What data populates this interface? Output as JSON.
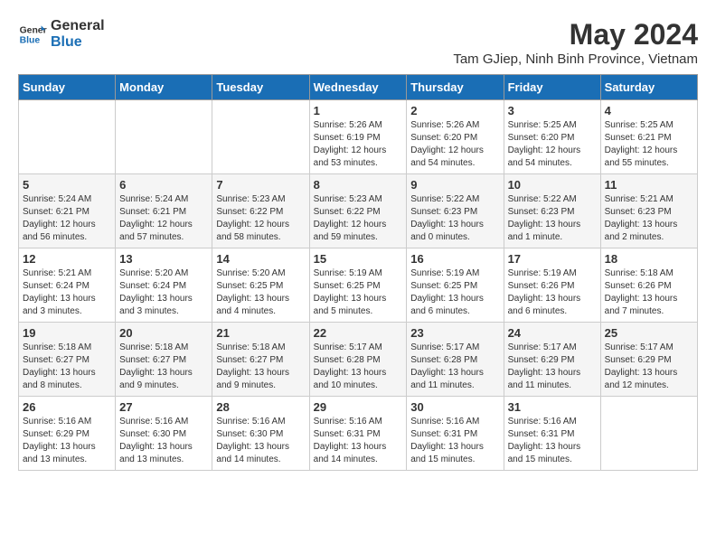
{
  "logo": {
    "line1": "General",
    "line2": "Blue"
  },
  "title": "May 2024",
  "location": "Tam GJiep, Ninh Binh Province, Vietnam",
  "days_of_week": [
    "Sunday",
    "Monday",
    "Tuesday",
    "Wednesday",
    "Thursday",
    "Friday",
    "Saturday"
  ],
  "weeks": [
    [
      {
        "day": "",
        "info": ""
      },
      {
        "day": "",
        "info": ""
      },
      {
        "day": "",
        "info": ""
      },
      {
        "day": "1",
        "info": "Sunrise: 5:26 AM\nSunset: 6:19 PM\nDaylight: 12 hours\nand 53 minutes."
      },
      {
        "day": "2",
        "info": "Sunrise: 5:26 AM\nSunset: 6:20 PM\nDaylight: 12 hours\nand 54 minutes."
      },
      {
        "day": "3",
        "info": "Sunrise: 5:25 AM\nSunset: 6:20 PM\nDaylight: 12 hours\nand 54 minutes."
      },
      {
        "day": "4",
        "info": "Sunrise: 5:25 AM\nSunset: 6:21 PM\nDaylight: 12 hours\nand 55 minutes."
      }
    ],
    [
      {
        "day": "5",
        "info": "Sunrise: 5:24 AM\nSunset: 6:21 PM\nDaylight: 12 hours\nand 56 minutes."
      },
      {
        "day": "6",
        "info": "Sunrise: 5:24 AM\nSunset: 6:21 PM\nDaylight: 12 hours\nand 57 minutes."
      },
      {
        "day": "7",
        "info": "Sunrise: 5:23 AM\nSunset: 6:22 PM\nDaylight: 12 hours\nand 58 minutes."
      },
      {
        "day": "8",
        "info": "Sunrise: 5:23 AM\nSunset: 6:22 PM\nDaylight: 12 hours\nand 59 minutes."
      },
      {
        "day": "9",
        "info": "Sunrise: 5:22 AM\nSunset: 6:23 PM\nDaylight: 13 hours\nand 0 minutes."
      },
      {
        "day": "10",
        "info": "Sunrise: 5:22 AM\nSunset: 6:23 PM\nDaylight: 13 hours\nand 1 minute."
      },
      {
        "day": "11",
        "info": "Sunrise: 5:21 AM\nSunset: 6:23 PM\nDaylight: 13 hours\nand 2 minutes."
      }
    ],
    [
      {
        "day": "12",
        "info": "Sunrise: 5:21 AM\nSunset: 6:24 PM\nDaylight: 13 hours\nand 3 minutes."
      },
      {
        "day": "13",
        "info": "Sunrise: 5:20 AM\nSunset: 6:24 PM\nDaylight: 13 hours\nand 3 minutes."
      },
      {
        "day": "14",
        "info": "Sunrise: 5:20 AM\nSunset: 6:25 PM\nDaylight: 13 hours\nand 4 minutes."
      },
      {
        "day": "15",
        "info": "Sunrise: 5:19 AM\nSunset: 6:25 PM\nDaylight: 13 hours\nand 5 minutes."
      },
      {
        "day": "16",
        "info": "Sunrise: 5:19 AM\nSunset: 6:25 PM\nDaylight: 13 hours\nand 6 minutes."
      },
      {
        "day": "17",
        "info": "Sunrise: 5:19 AM\nSunset: 6:26 PM\nDaylight: 13 hours\nand 6 minutes."
      },
      {
        "day": "18",
        "info": "Sunrise: 5:18 AM\nSunset: 6:26 PM\nDaylight: 13 hours\nand 7 minutes."
      }
    ],
    [
      {
        "day": "19",
        "info": "Sunrise: 5:18 AM\nSunset: 6:27 PM\nDaylight: 13 hours\nand 8 minutes."
      },
      {
        "day": "20",
        "info": "Sunrise: 5:18 AM\nSunset: 6:27 PM\nDaylight: 13 hours\nand 9 minutes."
      },
      {
        "day": "21",
        "info": "Sunrise: 5:18 AM\nSunset: 6:27 PM\nDaylight: 13 hours\nand 9 minutes."
      },
      {
        "day": "22",
        "info": "Sunrise: 5:17 AM\nSunset: 6:28 PM\nDaylight: 13 hours\nand 10 minutes."
      },
      {
        "day": "23",
        "info": "Sunrise: 5:17 AM\nSunset: 6:28 PM\nDaylight: 13 hours\nand 11 minutes."
      },
      {
        "day": "24",
        "info": "Sunrise: 5:17 AM\nSunset: 6:29 PM\nDaylight: 13 hours\nand 11 minutes."
      },
      {
        "day": "25",
        "info": "Sunrise: 5:17 AM\nSunset: 6:29 PM\nDaylight: 13 hours\nand 12 minutes."
      }
    ],
    [
      {
        "day": "26",
        "info": "Sunrise: 5:16 AM\nSunset: 6:29 PM\nDaylight: 13 hours\nand 13 minutes."
      },
      {
        "day": "27",
        "info": "Sunrise: 5:16 AM\nSunset: 6:30 PM\nDaylight: 13 hours\nand 13 minutes."
      },
      {
        "day": "28",
        "info": "Sunrise: 5:16 AM\nSunset: 6:30 PM\nDaylight: 13 hours\nand 14 minutes."
      },
      {
        "day": "29",
        "info": "Sunrise: 5:16 AM\nSunset: 6:31 PM\nDaylight: 13 hours\nand 14 minutes."
      },
      {
        "day": "30",
        "info": "Sunrise: 5:16 AM\nSunset: 6:31 PM\nDaylight: 13 hours\nand 15 minutes."
      },
      {
        "day": "31",
        "info": "Sunrise: 5:16 AM\nSunset: 6:31 PM\nDaylight: 13 hours\nand 15 minutes."
      },
      {
        "day": "",
        "info": ""
      }
    ]
  ]
}
